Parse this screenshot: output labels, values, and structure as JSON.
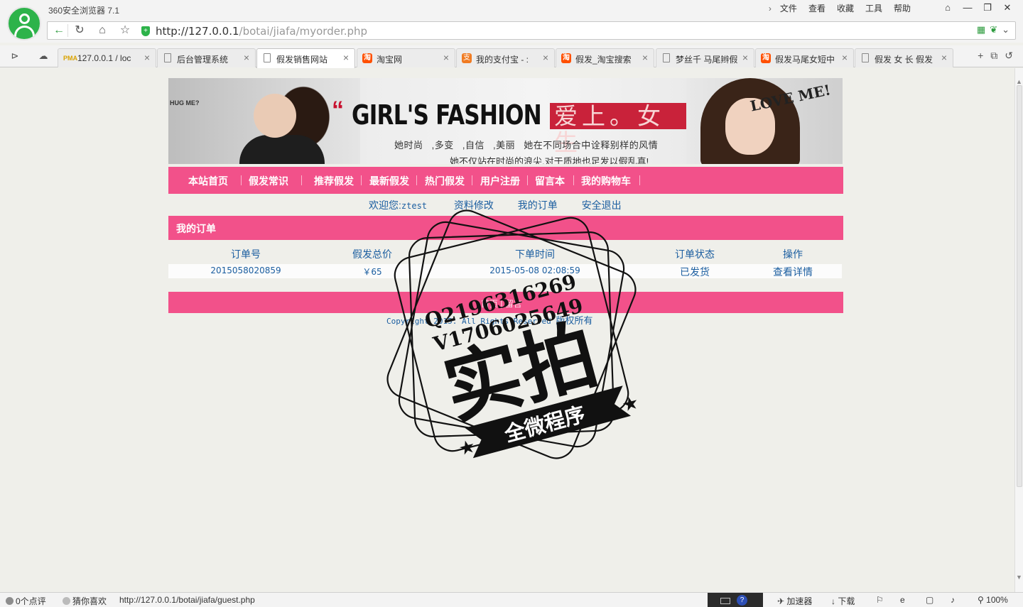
{
  "browser": {
    "app_title": "360安全浏览器 7.1",
    "menu": [
      "文件",
      "查看",
      "收藏",
      "工具",
      "帮助"
    ],
    "url_host": "http://127.0.0.1",
    "url_path": "/botai/jiafa/myorder.php"
  },
  "tabs": [
    {
      "label": "127.0.0.1 / loc",
      "icon": "phpmyadmin-icon",
      "active": false
    },
    {
      "label": "后台管理系统",
      "icon": "document-icon",
      "active": false
    },
    {
      "label": "假发销售网站",
      "icon": "document-icon",
      "active": true
    },
    {
      "label": "淘宝网",
      "icon": "taobao-icon",
      "active": false
    },
    {
      "label": "我的支付宝 - :",
      "icon": "alipay-icon",
      "active": false
    },
    {
      "label": "假发_淘宝搜索",
      "icon": "taobao-icon",
      "active": false
    },
    {
      "label": "梦丝千 马尾辫假",
      "icon": "document-icon",
      "active": false
    },
    {
      "label": "假发马尾女短中",
      "icon": "taobao-icon",
      "active": false
    },
    {
      "label": "假发 女 长 假发",
      "icon": "document-icon",
      "active": false
    }
  ],
  "banner": {
    "left_badge": "HUG ME?",
    "quote_mark": "“",
    "headline": "GIRL'S FASHION",
    "headline_zh": "爱上。女生",
    "love_text": "LOVE ME!",
    "line1": "她时尚 ,多变 ,自信 ,美丽 她在不同场合中诠释别样的风情",
    "line2": "她不仅站在时尚的浪尖,对于质地也足发以假乱真!"
  },
  "nav": [
    "本站首页",
    "假发常识",
    "推荐假发",
    "最新假发",
    "热门假发",
    "用户注册",
    "留言本",
    "我的购物车"
  ],
  "welcome": {
    "prefix": "欢迎您:",
    "username": "ztest",
    "links": [
      "资料修改",
      "我的订单",
      "安全退出"
    ]
  },
  "section_title": "我的订单",
  "orders": {
    "headers": [
      "订单号",
      "假发总价",
      "下单时间",
      "订单状态",
      "操作"
    ],
    "rows": [
      {
        "order_no": "2015058020859",
        "total": "￥65",
        "time": "2015-05-08 02:08:59",
        "status": "已发货",
        "action": "查看详情"
      }
    ]
  },
  "footer": {
    "links": "首页 | 留言",
    "copyright": "Copyright 2015. All Rights Reserved",
    "copyright_zh": "版权所有"
  },
  "watermark": {
    "qq": "Q2196316269",
    "wx": "V1706025649",
    "big": "实拍",
    "ribbon": "全微程序"
  },
  "statusbar": {
    "reviews": "0个点评",
    "guess": "猜你喜欢",
    "hover_url": "http://127.0.0.1/botai/jiafa/guest.php",
    "accelerator": "加速器",
    "download": "下载",
    "zoom": "100%"
  }
}
